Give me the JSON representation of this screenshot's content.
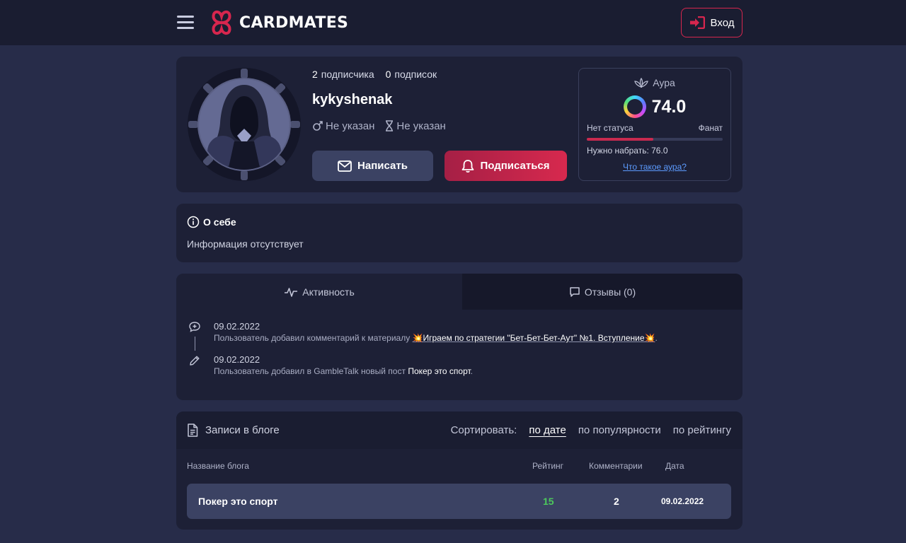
{
  "header": {
    "logo_text": "CARDMATES",
    "login_label": "Вход"
  },
  "profile": {
    "followers_count": "2",
    "followers_label": "подписчика",
    "following_count": "0",
    "following_label": "подписок",
    "username": "kykyshenak",
    "gender": "Не указан",
    "age": "Не указан",
    "write_label": "Написать",
    "subscribe_label": "Подписаться"
  },
  "aura": {
    "title": "Аура",
    "value": "74.0",
    "status_left": "Нет статуса",
    "status_right": "Фанат",
    "progress_percent": 49,
    "need_text": "Нужно набрать: 76.0",
    "link_text": "Что такое аура?"
  },
  "about": {
    "title": "О себе",
    "text": "Информация отсутствует"
  },
  "activity": {
    "tabs": [
      {
        "label": "Активность"
      },
      {
        "label": "Отзывы (0)"
      }
    ],
    "items": [
      {
        "date": "09.02.2022",
        "text": "Пользователь добавил комментарий к материалу",
        "link": "💥Играем по стратегии \"Бет-Бет-Бет-Аут\" №1. Вступление💥",
        "suffix": "."
      },
      {
        "date": "09.02.2022",
        "text": "Пользователь добавил в GambleTalk новый пост",
        "link": "Покер это спорт",
        "suffix": "."
      }
    ]
  },
  "blog": {
    "title": "Записи в блоге",
    "sort_label": "Сортировать:",
    "sort_options": [
      "по дате",
      "по популярности",
      "по рейтингу"
    ],
    "columns": {
      "name": "Название блога",
      "rating": "Рейтинг",
      "comments": "Комментарии",
      "date": "Дата"
    },
    "rows": [
      {
        "name": "Покер это спорт",
        "rating": "15",
        "comments": "2",
        "date": "09.02.2022"
      }
    ]
  },
  "colors": {
    "accent": "#d7264e",
    "page_bg": "#272c49",
    "card_bg": "#1d2036",
    "positive": "#4cc95c",
    "link": "#5c9bff"
  }
}
